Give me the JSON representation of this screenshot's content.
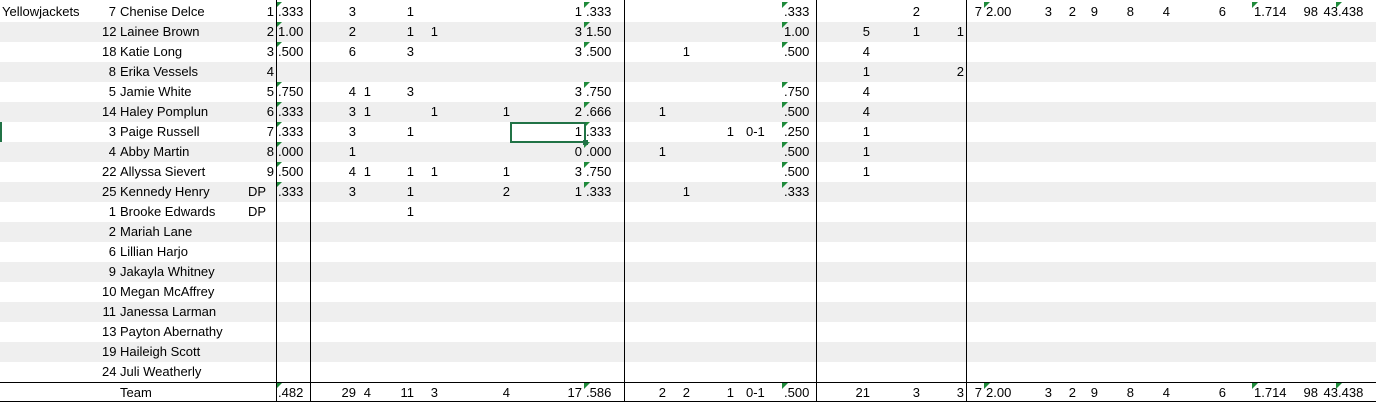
{
  "team_name": "Yellowjackets",
  "accent_color": "#217346",
  "comment_color": "#1e8a3a",
  "players": [
    {
      "num": "7",
      "name": "Chenise Delce",
      "c1": "1",
      "c2": ".333",
      "c3": "3",
      "c4": "1",
      "c5": "",
      "c6": "",
      "c7": "",
      "c8": "1",
      "c9": ".333",
      "c10": "",
      "c11": "",
      "c12": "",
      "c13": "",
      "c14": ".333",
      "c15": "",
      "c16": "2",
      "c17": "",
      "c18": "7",
      "c19": "2.00",
      "c20": "3",
      "c21": "2",
      "c22": "9",
      "c23": "8",
      "c24": "4",
      "c25": "6",
      "c26": "1.714",
      "c27": "98",
      "c28": "43",
      "c29": ".438"
    },
    {
      "num": "12",
      "name": "Lainee Brown",
      "c1": "2",
      "c2": "1.00",
      "c3": "2",
      "c4": "1",
      "c5": "1",
      "c6": "",
      "c7": "",
      "c8": "3",
      "c9": "1.50",
      "c10": "",
      "c11": "",
      "c12": "",
      "c13": "",
      "c14": "1.00",
      "c15": "5",
      "c16": "1",
      "c17": "1"
    },
    {
      "num": "18",
      "name": "Katie Long",
      "c1": "3",
      "c2": ".500",
      "c3": "6",
      "c4": "3",
      "c5": "",
      "c6": "",
      "c7": "",
      "c8": "3",
      "c9": ".500",
      "c10": "",
      "c11": "1",
      "c12": "",
      "c13": "",
      "c14": ".500",
      "c15": "4",
      "c16": "",
      "c17": ""
    },
    {
      "num": "8",
      "name": "Erika Vessels",
      "c1": "4",
      "c2": "",
      "c3": "",
      "c4": "",
      "c5": "",
      "c6": "",
      "c7": "",
      "c8": "",
      "c9": "",
      "c10": "",
      "c11": "",
      "c12": "",
      "c13": "",
      "c14": "",
      "c15": "1",
      "c16": "",
      "c17": "2"
    },
    {
      "num": "5",
      "name": "Jamie White",
      "c1": "5",
      "c2": ".750",
      "c3": "4",
      "c3b": "1",
      "c4": "3",
      "c5": "",
      "c6": "",
      "c7": "",
      "c8": "3",
      "c9": ".750",
      "c10": "",
      "c11": "",
      "c12": "",
      "c13": "",
      "c14": ".750",
      "c15": "4",
      "c16": "",
      "c17": ""
    },
    {
      "num": "14",
      "name": "Haley Pomplun",
      "c1": "6",
      "c2": ".333",
      "c3": "3",
      "c3b": "1",
      "c4": "",
      "c5": "1",
      "c6": "",
      "c7": "1",
      "c8": "2",
      "c9": ".666",
      "c10": "1",
      "c11": "",
      "c12": "",
      "c13": "",
      "c14": ".500",
      "c15": "4",
      "c16": "",
      "c17": ""
    },
    {
      "num": "3",
      "name": "Paige Russell",
      "c1": "7",
      "c2": ".333",
      "c3": "3",
      "c4": "1",
      "c5": "",
      "c6": "",
      "c7": "",
      "c8": "1",
      "c9": ".333",
      "c10": "",
      "c11": "",
      "c12": "1",
      "c13": "0-1",
      "c14": ".250",
      "c15": "1",
      "c16": "",
      "c17": ""
    },
    {
      "num": "4",
      "name": "Abby Martin",
      "c1": "8",
      "c2": ".000",
      "c3": "1",
      "c4": "",
      "c5": "",
      "c6": "",
      "c7": "",
      "c8": "0",
      "c9": ".000",
      "c10": "1",
      "c11": "",
      "c12": "",
      "c13": "",
      "c14": ".500",
      "c15": "1",
      "c16": "",
      "c17": ""
    },
    {
      "num": "22",
      "name": "Allyssa Sievert",
      "c1": "9",
      "c2": ".500",
      "c3": "4",
      "c3b": "1",
      "c4": "1",
      "c5": "1",
      "c6": "",
      "c7": "1",
      "c8": "3",
      "c9": ".750",
      "c10": "",
      "c11": "",
      "c12": "",
      "c13": "",
      "c14": ".500",
      "c15": "1",
      "c16": "",
      "c17": ""
    },
    {
      "num": "25",
      "name": "Kennedy Henry",
      "pos": "DP",
      "c1": "",
      "c2": ".333",
      "c3": "3",
      "c4": "1",
      "c5": "",
      "c6": "",
      "c7": "2",
      "c8": "1",
      "c9": ".333",
      "c10": "",
      "c11": "1",
      "c12": "",
      "c13": "",
      "c14": ".333",
      "c15": "",
      "c16": "",
      "c17": ""
    },
    {
      "num": "1",
      "name": "Brooke Edwards",
      "pos": "DP",
      "c4": "1"
    },
    {
      "num": "2",
      "name": "Mariah Lane"
    },
    {
      "num": "6",
      "name": "Lillian Harjo"
    },
    {
      "num": "9",
      "name": "Jakayla Whitney"
    },
    {
      "num": "10",
      "name": "Megan McAffrey"
    },
    {
      "num": "11",
      "name": "Janessa Larman"
    },
    {
      "num": "13",
      "name": "Payton Abernathy"
    },
    {
      "num": "19",
      "name": "Haileigh Scott"
    },
    {
      "num": "24",
      "name": "Juli Weatherly"
    }
  ],
  "team_row": {
    "name": "Team",
    "c2": ".482",
    "c3": "29",
    "c3b": "4",
    "c4": "11",
    "c5": "3",
    "c7": "4",
    "c8": "17",
    "c9": ".586",
    "c10": "2",
    "c11": "2",
    "c12": "1",
    "c13": "0-1",
    "c14": ".500",
    "c15": "21",
    "c16": "3",
    "c17": "3",
    "c18": "7",
    "c19": "2.00",
    "c20": "3",
    "c21": "2",
    "c22": "9",
    "c23": "8",
    "c24": "4",
    "c25": "6",
    "c26": "1.714",
    "c27": "98",
    "c28": "43",
    "c29": ".438"
  }
}
